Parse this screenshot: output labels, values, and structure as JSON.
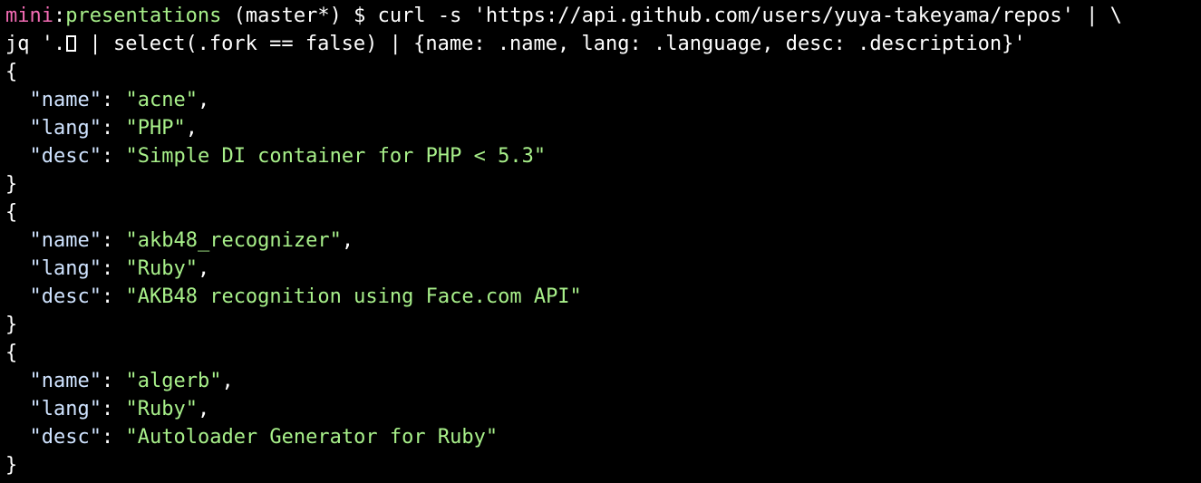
{
  "prompt": {
    "host": "mini",
    "separator": ":",
    "directory": "presentations",
    "branch": " (master*)",
    "symbol": " $ ",
    "command_line1": "curl -s 'https://api.github.com/users/yuya-takeyama/repos' | \\",
    "command_line2_prefix": "jq '.",
    "command_line2_suffix": " | select(.fork == false) | {name: .name, lang: .language, desc: .description}'"
  },
  "output": {
    "open_brace": "{",
    "close_brace": "}",
    "key_name": "\"name\"",
    "key_lang": "\"lang\"",
    "key_desc": "\"desc\"",
    "colon": ": ",
    "comma": ",",
    "records": [
      {
        "name": "\"acne\"",
        "lang": "\"PHP\"",
        "desc": "\"Simple DI container for PHP < 5.3\""
      },
      {
        "name": "\"akb48_recognizer\"",
        "lang": "\"Ruby\"",
        "desc": "\"AKB48 recognition using Face.com API\""
      },
      {
        "name": "\"algerb\"",
        "lang": "\"Ruby\"",
        "desc": "\"Autoloader Generator for Ruby\""
      }
    ]
  },
  "colors": {
    "background": "#000000",
    "host": "#f36bb4",
    "path": "#a8f08a",
    "string": "#a8f08a",
    "key": "#cfe3ff",
    "text": "#ffffff"
  }
}
